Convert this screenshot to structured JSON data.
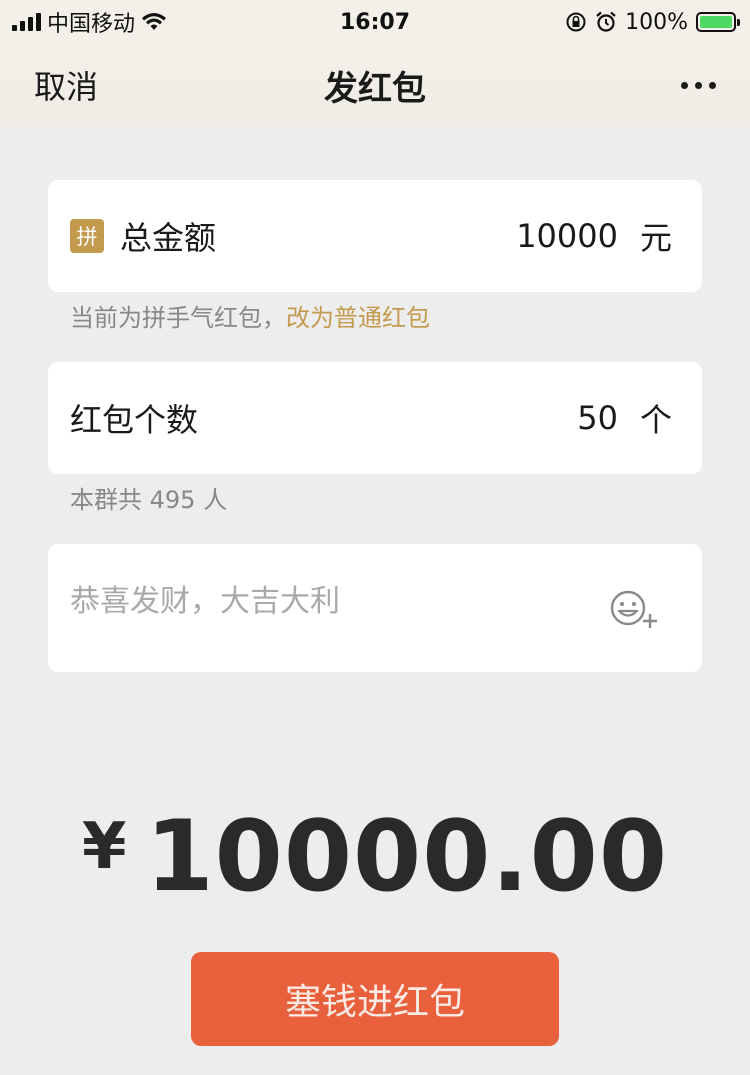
{
  "status_bar": {
    "carrier": "中国移动",
    "time": "16:07",
    "battery_text": "100%",
    "icons": [
      "signal-icon",
      "wifi-icon",
      "rotation-lock-icon",
      "alarm-icon",
      "battery-charging-icon"
    ]
  },
  "nav": {
    "cancel_label": "取消",
    "title": "发红包",
    "more_icon": "more-icon"
  },
  "amount": {
    "badge": "拼",
    "label": "总金额",
    "value": "10000",
    "unit": "元",
    "hint_prefix": "当前为拼手气红包，",
    "hint_link": "改为普通红包"
  },
  "count": {
    "label": "红包个数",
    "value": "50",
    "unit": "个",
    "hint": "本群共 495 人"
  },
  "greeting": {
    "placeholder": "恭喜发财，大吉大利",
    "emoji_icon": "emoji-add-icon"
  },
  "total": {
    "currency": "¥",
    "amount": "10000.00"
  },
  "submit_label": "塞钱进红包",
  "colors": {
    "accent_gold": "#c49a4f",
    "submit_bg": "#e8603c",
    "page_bg": "#ededed"
  }
}
